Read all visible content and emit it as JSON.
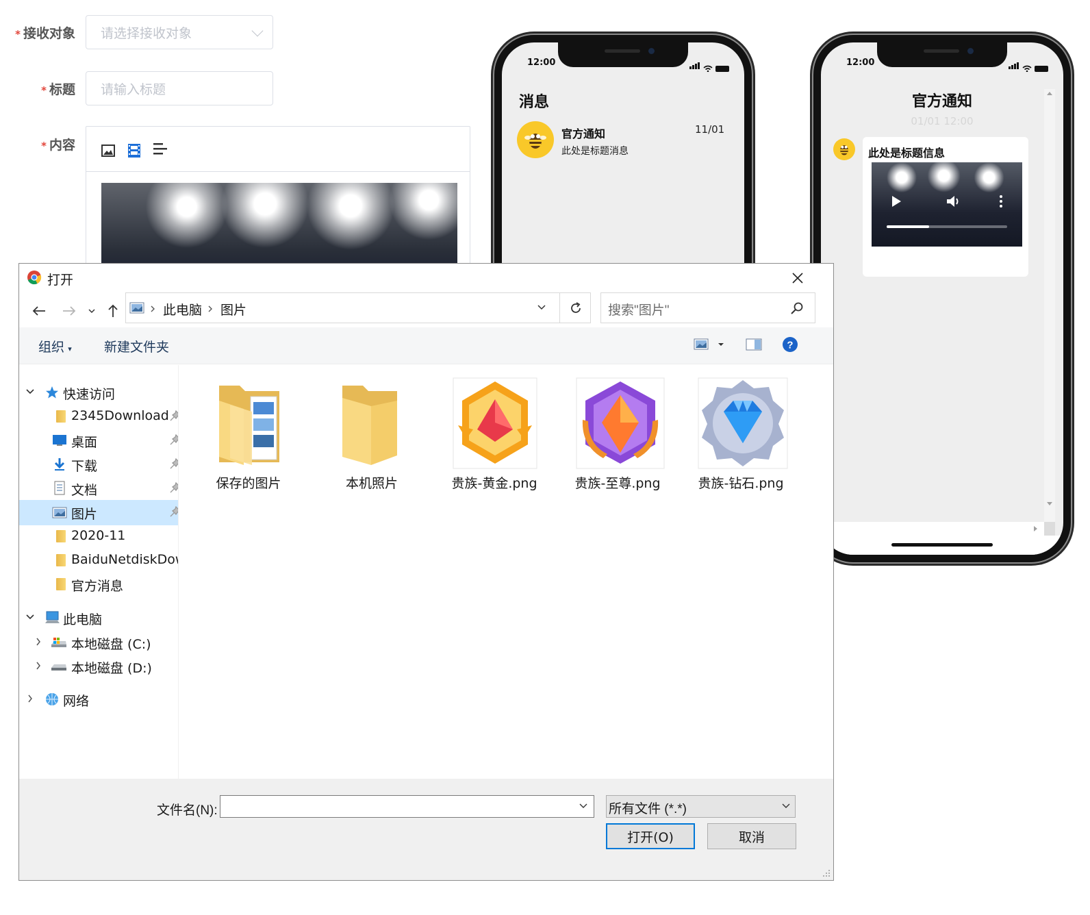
{
  "form": {
    "recipient_label": "接收对象",
    "recipient_placeholder": "请选择接收对象",
    "title_label": "标题",
    "title_placeholder": "请输入标题",
    "content_label": "内容",
    "required_mark": "*"
  },
  "phone_left": {
    "time": "12:00",
    "header": "消息",
    "message": {
      "title": "官方通知",
      "preview": "此处是标题消息",
      "date": "11/01"
    }
  },
  "phone_right": {
    "time": "12:00",
    "title": "官方通知",
    "timestamp": "01/01 12:00",
    "bubble_title": "此处是标题信息",
    "video_progress": 0.35
  },
  "dialog": {
    "title": "打开",
    "breadcrumb": [
      "此电脑",
      "图片"
    ],
    "search_placeholder": "搜索\"图片\"",
    "toolbar": {
      "organize": "组织",
      "new_folder": "新建文件夹"
    },
    "nav": {
      "quick_access": "快速访问",
      "quick_items": [
        {
          "label": "2345Download",
          "icon": "folder-icon",
          "pinned": true
        },
        {
          "label": "桌面",
          "icon": "desktop-icon",
          "pinned": true
        },
        {
          "label": "下载",
          "icon": "download-icon",
          "pinned": true
        },
        {
          "label": "文档",
          "icon": "document-icon",
          "pinned": true
        },
        {
          "label": "图片",
          "icon": "pictures-icon",
          "pinned": true,
          "selected": true
        },
        {
          "label": "2020-11",
          "icon": "folder-icon",
          "pinned": false
        },
        {
          "label": "BaiduNetdiskDownload",
          "icon": "folder-icon",
          "pinned": false
        },
        {
          "label": "官方消息",
          "icon": "folder-icon",
          "pinned": false
        }
      ],
      "this_pc": "此电脑",
      "drives": [
        "本地磁盘 (C:)",
        "本地磁盘 (D:)"
      ],
      "network": "网络"
    },
    "files": [
      {
        "name": "保存的图片",
        "type": "folder-with-pictures"
      },
      {
        "name": "本机照片",
        "type": "folder"
      },
      {
        "name": "贵族-黄金.png",
        "type": "badge-gold"
      },
      {
        "name": "贵族-至尊.png",
        "type": "badge-supreme"
      },
      {
        "name": "贵族-钻石.png",
        "type": "badge-diamond"
      }
    ],
    "filename_label": "文件名(N):",
    "filename_value": "",
    "filter_value": "所有文件 (*.*)",
    "open_button": "打开(O)",
    "cancel_button": "取消"
  },
  "colors": {
    "required": "#e2463b",
    "accent": "#0078d7",
    "selected_row": "#cce8ff",
    "avatar_yellow": "#f9c829"
  }
}
